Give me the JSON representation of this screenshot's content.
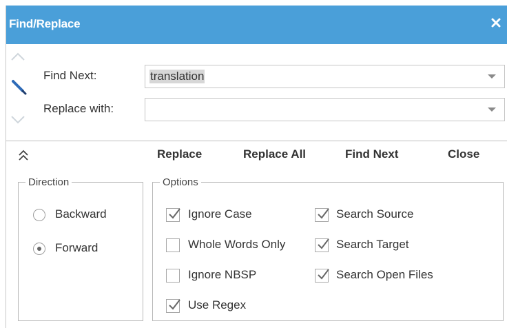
{
  "title": "Find/Replace",
  "find": {
    "find_label": "Find Next:",
    "find_value": "translation",
    "replace_label": "Replace with:",
    "replace_value": ""
  },
  "actions": {
    "replace": "Replace",
    "replace_all": "Replace All",
    "find_next": "Find Next",
    "close": "Close"
  },
  "direction": {
    "legend": "Direction",
    "options": [
      {
        "label": "Backward",
        "selected": false
      },
      {
        "label": "Forward",
        "selected": true
      }
    ]
  },
  "options": {
    "legend": "Options",
    "ignore_case": {
      "label": "Ignore Case",
      "checked": true
    },
    "whole_words": {
      "label": "Whole Words Only",
      "checked": false
    },
    "ignore_nbsp": {
      "label": "Ignore NBSP",
      "checked": false
    },
    "use_regex": {
      "label": "Use Regex",
      "checked": true
    },
    "search_source": {
      "label": "Search Source",
      "checked": true
    },
    "search_target": {
      "label": "Search Target",
      "checked": true
    },
    "search_open_files": {
      "label": "Search Open Files",
      "checked": true
    }
  },
  "colors": {
    "title_bar": "#4a9fd9",
    "text": "#333333",
    "border": "#b8b8b8"
  },
  "icons": [
    "close-icon",
    "chevron-up-icon",
    "chevron-down-icon",
    "pencil-icon",
    "double-chevron-up-icon",
    "dropdown-arrow-icon",
    "checkmark-icon"
  ]
}
